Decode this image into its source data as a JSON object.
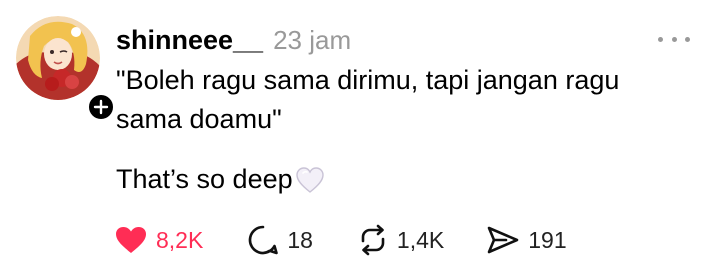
{
  "post": {
    "username": "shinneee__",
    "timestamp": "23 jam",
    "quote": "\"Boleh ragu sama dirimu, tapi jangan ragu sama doamu\"",
    "caption": "That’s so deep",
    "caption_emoji": "white-heart",
    "follow_badge": "+"
  },
  "actions": {
    "like_count": "8,2K",
    "reply_count": "18",
    "repost_count": "1,4K",
    "share_count": "191"
  },
  "colors": {
    "like": "#ff2d55",
    "muted": "#999999",
    "text": "#000000"
  }
}
